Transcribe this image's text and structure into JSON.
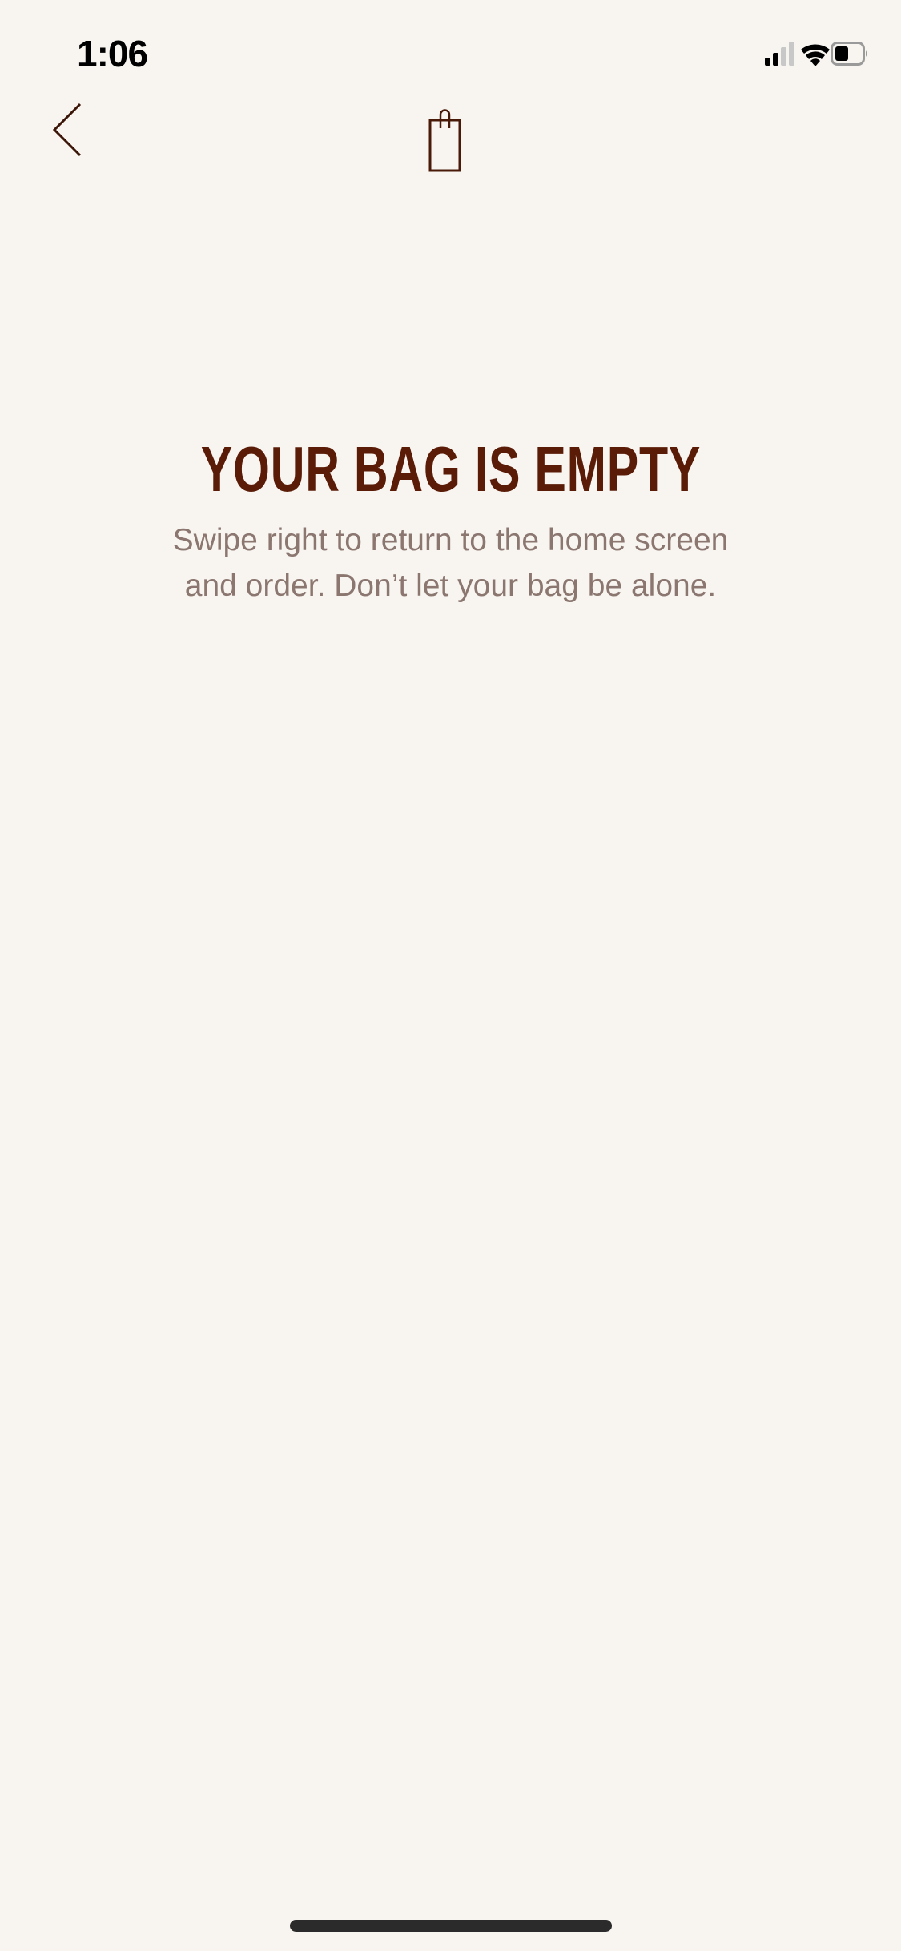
{
  "status_bar": {
    "time": "1:06",
    "signal_bars_active": 2,
    "signal_bars_total": 4,
    "battery_level": 0.5
  },
  "header": {
    "back_icon": "chevron-left-icon",
    "center_icon": "shopping-bag-icon"
  },
  "empty_state": {
    "title": "YOUR BAG IS EMPTY",
    "message": "Swipe right to return to the home screen and order. Don’t let your bag be alone."
  },
  "colors": {
    "background": "#f8f5f1",
    "title": "#5a1c07",
    "message": "#8b7670"
  }
}
